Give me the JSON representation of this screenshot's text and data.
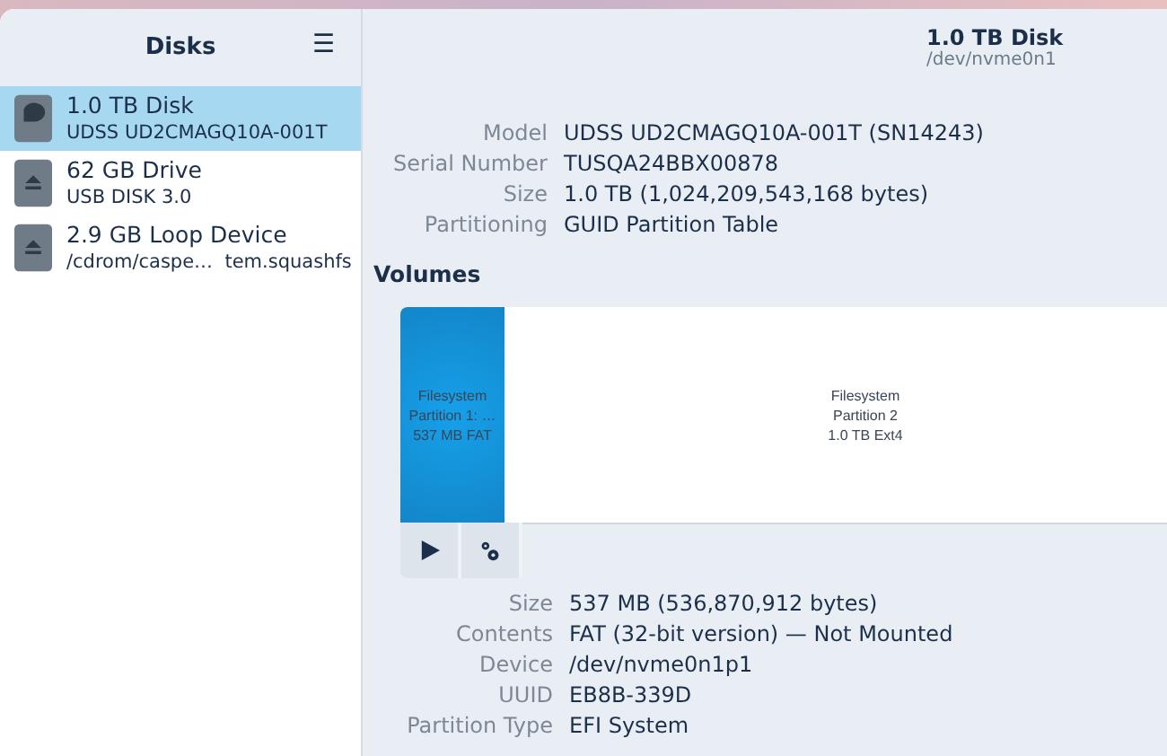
{
  "sidebar": {
    "title": "Disks",
    "menu_glyph": "☰",
    "items": [
      {
        "name": "1.0 TB Disk",
        "detail": "UDSS UD2CMAGQ10A-001T",
        "kind": "disk",
        "selected": true
      },
      {
        "name": "62 GB Drive",
        "detail": "USB DISK 3.0",
        "kind": "removable",
        "selected": false
      },
      {
        "name": "2.9 GB Loop Device",
        "detail": "/cdrom/caspe…  tem.squashfs",
        "kind": "removable",
        "selected": false
      }
    ]
  },
  "header": {
    "title": "1.0 TB Disk",
    "subtitle": "/dev/nvme0n1"
  },
  "disk_info": [
    {
      "label": "Model",
      "value": "UDSS UD2CMAGQ10A-001T (SN14243)"
    },
    {
      "label": "Serial Number",
      "value": "TUSQA24BBX00878"
    },
    {
      "label": "Size",
      "value": "1.0 TB (1,024,209,543,168 bytes)"
    },
    {
      "label": "Partitioning",
      "value": "GUID Partition Table"
    }
  ],
  "volumes": {
    "heading": "Volumes",
    "partitions": [
      {
        "lines": [
          "Filesystem",
          "Partition 1: …",
          "537 MB FAT"
        ],
        "selected": true
      },
      {
        "lines": [
          "Filesystem",
          "Partition 2",
          "1.0 TB Ext4"
        ],
        "selected": false
      }
    ]
  },
  "partition_info": [
    {
      "label": "Size",
      "value": "537 MB (536,870,912 bytes)"
    },
    {
      "label": "Contents",
      "value": "FAT (32-bit version) — Not Mounted"
    },
    {
      "label": "Device",
      "value": "/dev/nvme0n1p1"
    },
    {
      "label": "UUID",
      "value": "EB8B-339D"
    },
    {
      "label": "Partition Type",
      "value": "EFI System"
    }
  ]
}
